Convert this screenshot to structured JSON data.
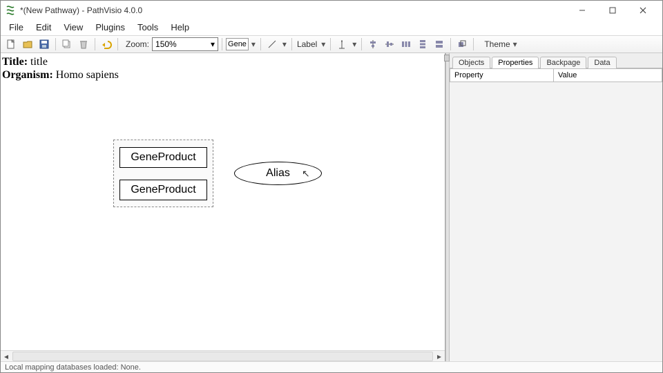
{
  "window": {
    "title": "*(New Pathway) - PathVisio 4.0.0"
  },
  "menubar": {
    "file": "File",
    "edit": "Edit",
    "view": "View",
    "plugins": "Plugins",
    "tools": "Tools",
    "help": "Help"
  },
  "toolbar": {
    "zoom_label": "Zoom:",
    "zoom_value": "150%",
    "node_tool": "Gene",
    "label_tool": "Label",
    "theme_label": "Theme"
  },
  "pathway": {
    "title_label": "Title:",
    "title_value": "title",
    "organism_label": "Organism:",
    "organism_value": "Homo sapiens"
  },
  "nodes": {
    "gene1": "GeneProduct",
    "gene2": "GeneProduct",
    "alias": "Alias"
  },
  "sidepanel": {
    "tabs": {
      "objects": "Objects",
      "properties": "Properties",
      "backpage": "Backpage",
      "data": "Data"
    },
    "columns": {
      "property": "Property",
      "value": "Value"
    }
  },
  "statusbar": {
    "text": "Local mapping databases loaded: None."
  }
}
